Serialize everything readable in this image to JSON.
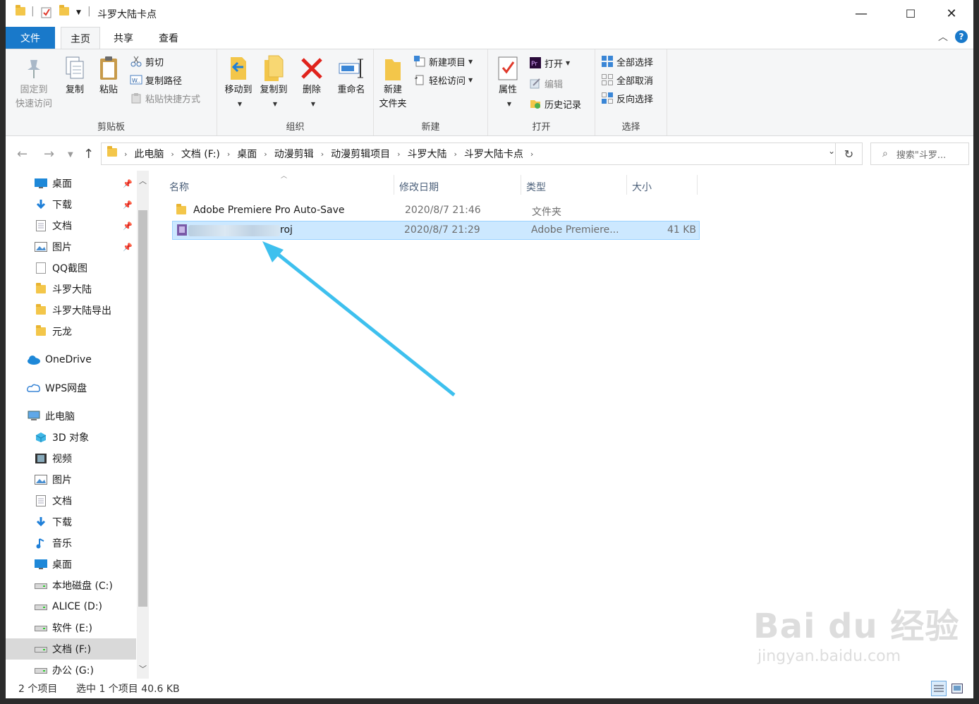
{
  "window": {
    "title": "斗罗大陆卡点",
    "controls": {
      "minimize": "—",
      "maximize": "☐",
      "close": "✕"
    }
  },
  "ribbon_tabs": [
    "文件",
    "主页",
    "共享",
    "查看"
  ],
  "ribbon": {
    "clipboard": {
      "label": "剪贴板",
      "pin_line1": "固定到",
      "pin_line2": "快速访问",
      "copy": "复制",
      "paste": "粘贴",
      "cut": "剪切",
      "copy_path": "复制路径",
      "paste_shortcut": "粘贴快捷方式"
    },
    "organize": {
      "label": "组织",
      "move_to": "移动到",
      "copy_to": "复制到",
      "delete": "删除",
      "rename": "重命名"
    },
    "new": {
      "label": "新建",
      "new_folder_line1": "新建",
      "new_folder_line2": "文件夹",
      "new_item": "新建项目",
      "easy_access": "轻松访问"
    },
    "open": {
      "label": "打开",
      "properties": "属性",
      "open": "打开",
      "edit": "编辑",
      "history": "历史记录"
    },
    "select": {
      "label": "选择",
      "select_all": "全部选择",
      "select_none": "全部取消",
      "invert": "反向选择"
    }
  },
  "address": {
    "crumbs": [
      "此电脑",
      "文档 (F:)",
      "桌面",
      "动漫剪辑",
      "动漫剪辑项目",
      "斗罗大陆",
      "斗罗大陆卡点"
    ],
    "search_placeholder": "搜索\"斗罗..."
  },
  "sidebar": {
    "quick_access": [
      {
        "label": "桌面",
        "icon": "desktop-icon",
        "pinned": true
      },
      {
        "label": "下载",
        "icon": "download-icon",
        "pinned": true
      },
      {
        "label": "文档",
        "icon": "document-icon",
        "pinned": true
      },
      {
        "label": "图片",
        "icon": "picture-icon",
        "pinned": true
      },
      {
        "label": "QQ截图",
        "icon": "file-icon",
        "pinned": false
      },
      {
        "label": "斗罗大陆",
        "icon": "folder-icon",
        "pinned": false
      },
      {
        "label": "斗罗大陆导出",
        "icon": "folder-icon",
        "pinned": false
      },
      {
        "label": "元龙",
        "icon": "folder-icon",
        "pinned": false
      }
    ],
    "onedrive": "OneDrive",
    "wps": "WPS网盘",
    "this_pc": "此电脑",
    "pc_items": [
      {
        "label": "3D 对象",
        "icon": "cube-icon"
      },
      {
        "label": "视频",
        "icon": "video-icon"
      },
      {
        "label": "图片",
        "icon": "picture-icon"
      },
      {
        "label": "文档",
        "icon": "document-icon"
      },
      {
        "label": "下载",
        "icon": "download-icon"
      },
      {
        "label": "音乐",
        "icon": "music-icon"
      },
      {
        "label": "桌面",
        "icon": "desktop-icon"
      },
      {
        "label": "本地磁盘 (C:)",
        "icon": "drive-icon"
      },
      {
        "label": "ALICE (D:)",
        "icon": "drive-icon"
      },
      {
        "label": "软件 (E:)",
        "icon": "drive-icon"
      },
      {
        "label": "文档 (F:)",
        "icon": "drive-icon",
        "selected": true
      },
      {
        "label": "办公 (G:)",
        "icon": "drive-icon"
      }
    ]
  },
  "columns": [
    "名称",
    "修改日期",
    "类型",
    "大小"
  ],
  "files": [
    {
      "name": "Adobe Premiere Pro Auto-Save",
      "date": "2020/8/7 21:46",
      "type": "文件夹",
      "size": "",
      "icon": "folder-icon"
    },
    {
      "name": "roj",
      "date": "2020/8/7 21:29",
      "type": "Adobe Premiere...",
      "size": "41 KB",
      "icon": "premiere-project-icon",
      "selected": true
    }
  ],
  "status": {
    "count": "2 个项目",
    "selection": "选中 1 个项目  40.6 KB"
  },
  "annotation": {
    "arrow_color": "#3ec0ee"
  },
  "watermark": {
    "logo": "Bai du 经验",
    "url": "jingyan.baidu.com"
  },
  "colors": {
    "accent": "#1979ca",
    "selection": "#cce8ff",
    "selection_border": "#99d1ff"
  }
}
